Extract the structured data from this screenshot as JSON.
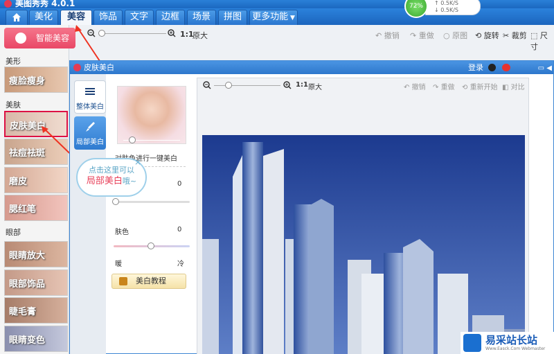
{
  "app": {
    "title": "美图秀秀 4.0.1"
  },
  "nav": {
    "tabs": [
      "美化",
      "美容",
      "饰品",
      "文字",
      "边框",
      "场景",
      "拼图"
    ],
    "more_label": "更多功能",
    "active": "美容"
  },
  "network": {
    "percent": "72%",
    "up": "0.5K/S",
    "down": "0.5K/S"
  },
  "toolbar": {
    "zoom_ratio": "1:1",
    "zoom_label": "原大",
    "undo": "撤销",
    "redo": "重做",
    "reset": "原图",
    "rotate": "旋转",
    "crop": "裁剪",
    "size": "尺寸"
  },
  "sidebar": {
    "smart_label": "智能美容",
    "sections": {
      "shape": "美形",
      "skin": "美肤",
      "eye": "眼部"
    },
    "items": [
      "瘦脸瘦身",
      "皮肤美白",
      "祛痘祛斑",
      "磨皮",
      "腮红笔",
      "眼睛放大",
      "眼部饰品",
      "睫毛膏",
      "眼睛变色"
    ]
  },
  "dialog": {
    "title": "皮肤美白",
    "login": "登录",
    "tabs": [
      "整体美白",
      "局部美白"
    ],
    "desc": "对肤色进行一键美白",
    "strength_value": "0",
    "skin_label": "肤色",
    "skin_value": "0",
    "warm_label": "暖",
    "cool_label": "冷",
    "tutorial": "美白教程",
    "img_toolbar": {
      "zoom_ratio": "1:1",
      "zoom_label": "原大",
      "undo": "撤销",
      "redo": "重做",
      "restart": "重新开始",
      "compare": "对比"
    }
  },
  "bubble": {
    "line1": "点击这里可以",
    "line2": "局部美白",
    "tail": "哦~"
  },
  "watermark": {
    "name": "易采站长站",
    "sub": "Www.Easck.Com Webmaster"
  },
  "colors": {
    "accent": "#2b7ad3",
    "pink": "#e94867",
    "bubble": "#9fd0ea"
  }
}
